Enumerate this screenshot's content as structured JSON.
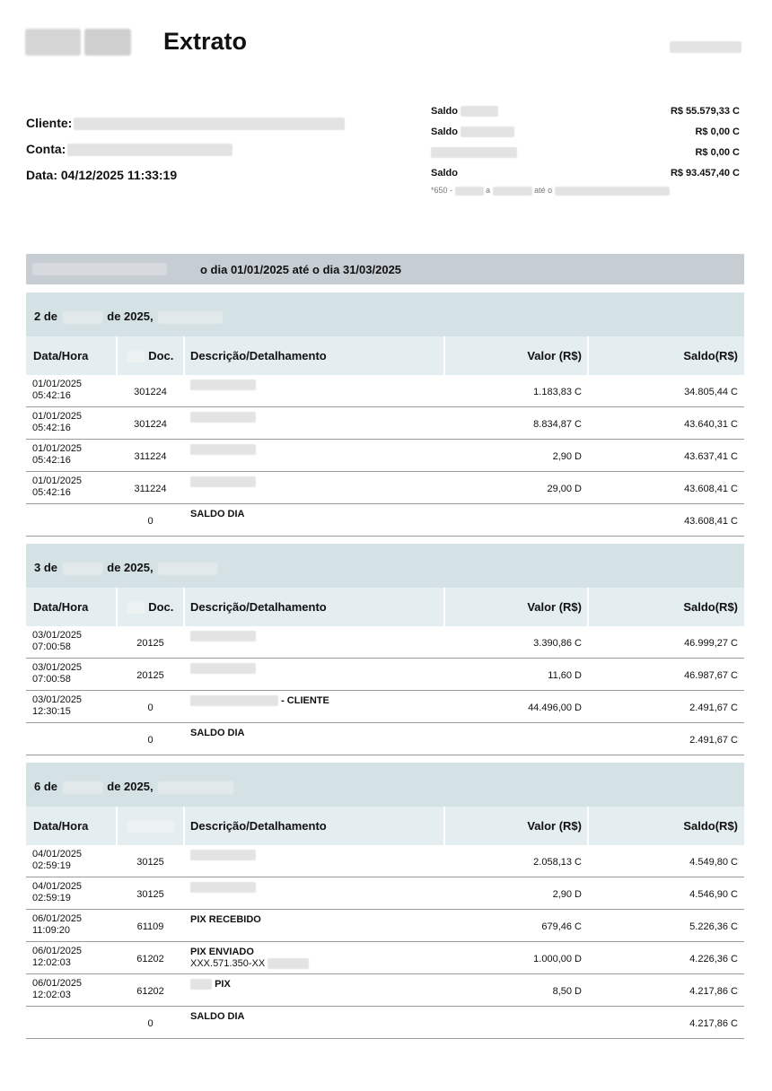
{
  "header": {
    "title": "Extrato",
    "cliente_label": "Cliente:",
    "conta_label": "Conta:",
    "data_label": "Data: 04/12/2025 11:33:19"
  },
  "balances": [
    {
      "label": "Saldo",
      "value": "R$ 55.579,33 C"
    },
    {
      "label": "Saldo",
      "value": "R$ 0,00 C"
    },
    {
      "label": "",
      "value": "R$ 0,00 C"
    },
    {
      "label": "Saldo",
      "value": "R$ 93.457,40 C"
    }
  ],
  "balance_note": {
    "prefix": "*650 -",
    "mid1": "a",
    "mid2": "até o"
  },
  "period": {
    "text": "o dia 01/01/2025 até o dia 31/03/2025"
  },
  "columns": {
    "date": "Data/Hora",
    "doc": "Doc.",
    "desc": "Descrição/Detalhamento",
    "value": "Valor (R$)",
    "balance": "Saldo(R$)"
  },
  "days": [
    {
      "day_prefix": "2 de",
      "day_suffix": "de 2025,",
      "rows": [
        {
          "date1": "01/01/2025",
          "date2": "05:42:16",
          "doc": "301224",
          "desc": "",
          "value": "1.183,83 C",
          "balance": "34.805,44 C"
        },
        {
          "date1": "01/01/2025",
          "date2": "05:42:16",
          "doc": "301224",
          "desc": "",
          "value": "8.834,87 C",
          "balance": "43.640,31 C"
        },
        {
          "date1": "01/01/2025",
          "date2": "05:42:16",
          "doc": "311224",
          "desc": "",
          "value": "2,90 D",
          "balance": "43.637,41 C"
        },
        {
          "date1": "01/01/2025",
          "date2": "05:42:16",
          "doc": "311224",
          "desc": "",
          "value": "29,00 D",
          "balance": "43.608,41 C"
        },
        {
          "date1": "",
          "date2": "",
          "doc": "0",
          "desc": "SALDO DIA",
          "value": "",
          "balance": "43.608,41 C"
        }
      ]
    },
    {
      "day_prefix": "3 de",
      "day_suffix": "de 2025,",
      "rows": [
        {
          "date1": "03/01/2025",
          "date2": "07:00:58",
          "doc": "20125",
          "desc": "",
          "value": "3.390,86 C",
          "balance": "46.999,27 C"
        },
        {
          "date1": "03/01/2025",
          "date2": "07:00:58",
          "doc": "20125",
          "desc": "",
          "value": "11,60 D",
          "balance": "46.987,67 C"
        },
        {
          "date1": "03/01/2025",
          "date2": "12:30:15",
          "doc": "0",
          "desc": "- CLIENTE",
          "value": "44.496,00 D",
          "balance": "2.491,67 C"
        },
        {
          "date1": "",
          "date2": "",
          "doc": "0",
          "desc": "SALDO DIA",
          "value": "",
          "balance": "2.491,67 C"
        }
      ]
    },
    {
      "day_prefix": "6 de",
      "day_suffix": "de 2025,",
      "rows": [
        {
          "date1": "04/01/2025",
          "date2": "02:59:19",
          "doc": "30125",
          "desc": "",
          "value": "2.058,13 C",
          "balance": "4.549,80 C"
        },
        {
          "date1": "04/01/2025",
          "date2": "02:59:19",
          "doc": "30125",
          "desc": "",
          "value": "2,90 D",
          "balance": "4.546,90 C"
        },
        {
          "date1": "06/01/2025",
          "date2": "11:09:20",
          "doc": "61109",
          "desc": "PIX RECEBIDO",
          "value": "679,46 C",
          "balance": "5.226,36 C"
        },
        {
          "date1": "06/01/2025",
          "date2": "12:02:03",
          "doc": "61202",
          "desc": "PIX ENVIADO",
          "desc2": "XXX.571.350-XX",
          "value": "1.000,00 D",
          "balance": "4.226,36 C"
        },
        {
          "date1": "06/01/2025",
          "date2": "12:02:03",
          "doc": "61202",
          "desc": "PIX",
          "value": "8,50 D",
          "balance": "4.217,86 C"
        },
        {
          "date1": "",
          "date2": "",
          "doc": "0",
          "desc": "SALDO DIA",
          "value": "",
          "balance": "4.217,86 C"
        }
      ]
    }
  ]
}
